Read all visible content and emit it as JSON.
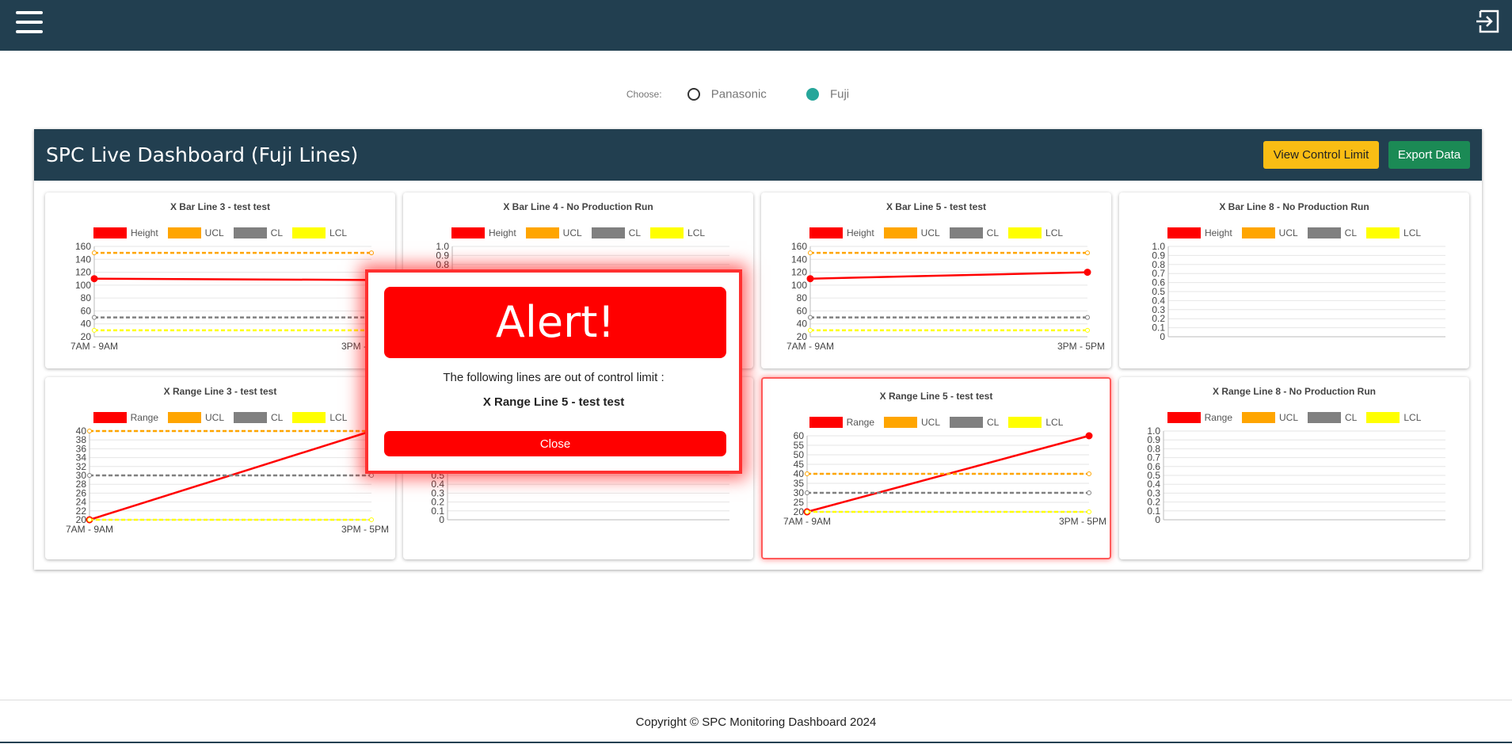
{
  "chooser": {
    "label": "Choose:",
    "options": [
      {
        "label": "Panasonic",
        "selected": false
      },
      {
        "label": "Fuji",
        "selected": true
      }
    ]
  },
  "dashboard": {
    "title": "SPC Live Dashboard (Fuji Lines)",
    "view_control_limit_label": "View Control Limit",
    "export_label": "Export Data"
  },
  "legend_colors": {
    "main": "#ff0000",
    "UCL": "#ffa500",
    "CL": "#808080",
    "LCL": "#ffff00"
  },
  "chart_data": [
    {
      "type": "line",
      "title": "X Bar Line 3 - test test",
      "series_label": "Height",
      "categories": [
        "7AM - 9AM",
        "3PM - 5PM"
      ],
      "series": [
        {
          "name": "Height",
          "values": [
            110,
            108
          ]
        },
        {
          "name": "UCL",
          "values": [
            150,
            150
          ]
        },
        {
          "name": "CL",
          "values": [
            50,
            50
          ]
        },
        {
          "name": "LCL",
          "values": [
            30,
            30
          ]
        }
      ],
      "yticks": [
        20,
        40,
        60,
        80,
        100,
        120,
        140,
        160
      ],
      "ylim": [
        20,
        160
      ]
    },
    {
      "type": "line",
      "title": "X Bar Line 4 - No Production Run",
      "series_label": "Height",
      "categories": [],
      "series": [],
      "yticks": [
        0.8,
        0.9,
        1.0
      ],
      "ylim": [
        0,
        1
      ]
    },
    {
      "type": "line",
      "title": "X Bar Line 5 - test test",
      "series_label": "Height",
      "categories": [
        "7AM - 9AM",
        "3PM - 5PM"
      ],
      "series": [
        {
          "name": "Height",
          "values": [
            110,
            120
          ]
        },
        {
          "name": "UCL",
          "values": [
            150,
            150
          ]
        },
        {
          "name": "CL",
          "values": [
            50,
            50
          ]
        },
        {
          "name": "LCL",
          "values": [
            30,
            30
          ]
        }
      ],
      "yticks": [
        20,
        40,
        60,
        80,
        100,
        120,
        140,
        160
      ],
      "ylim": [
        20,
        160
      ]
    },
    {
      "type": "line",
      "title": "X Bar Line 8 - No Production Run",
      "series_label": "Height",
      "categories": [],
      "series": [],
      "yticks": [
        0,
        0.1,
        0.2,
        0.3,
        0.4,
        0.5,
        0.6,
        0.7,
        0.8,
        0.9,
        1.0
      ],
      "ylim": [
        0,
        1
      ]
    },
    {
      "type": "line",
      "title": "X Range Line 3 - test test",
      "series_label": "Range",
      "categories": [
        "7AM - 9AM",
        "3PM - 5PM"
      ],
      "series": [
        {
          "name": "Range",
          "values": [
            20,
            40
          ]
        },
        {
          "name": "UCL",
          "values": [
            40,
            40
          ]
        },
        {
          "name": "CL",
          "values": [
            30,
            30
          ]
        },
        {
          "name": "LCL",
          "values": [
            20,
            20
          ]
        }
      ],
      "yticks": [
        20,
        22,
        24,
        26,
        28,
        30,
        32,
        34,
        36,
        38,
        40
      ],
      "ylim": [
        20,
        40
      ]
    },
    {
      "type": "line",
      "title": "",
      "series_label": "",
      "categories": [],
      "series": [],
      "yticks": [
        0,
        0.1,
        0.2,
        0.3,
        0.4,
        0.5
      ],
      "ylim": [
        0,
        1
      ]
    },
    {
      "type": "line",
      "title": "X Range Line 5 - test test",
      "series_label": "Range",
      "categories": [
        "7AM - 9AM",
        "3PM - 5PM"
      ],
      "series": [
        {
          "name": "Range",
          "values": [
            20,
            60
          ]
        },
        {
          "name": "UCL",
          "values": [
            40,
            40
          ]
        },
        {
          "name": "CL",
          "values": [
            30,
            30
          ]
        },
        {
          "name": "LCL",
          "values": [
            20,
            20
          ]
        }
      ],
      "yticks": [
        20,
        25,
        30,
        35,
        40,
        45,
        50,
        55,
        60
      ],
      "ylim": [
        20,
        60
      ]
    },
    {
      "type": "line",
      "title": "X Range Line 8 - No Production Run",
      "series_label": "Range",
      "categories": [],
      "series": [],
      "yticks": [
        0,
        0.1,
        0.2,
        0.3,
        0.4,
        0.5,
        0.6,
        0.7,
        0.8,
        0.9,
        1.0
      ],
      "ylim": [
        0,
        1
      ]
    }
  ],
  "alert": {
    "title": "Alert!",
    "message": "The following lines are out of control limit :",
    "line": "X Range Line 5 - test test",
    "close_label": "Close"
  },
  "footer": {
    "text": "Copyright © SPC Monitoring Dashboard 2024"
  }
}
